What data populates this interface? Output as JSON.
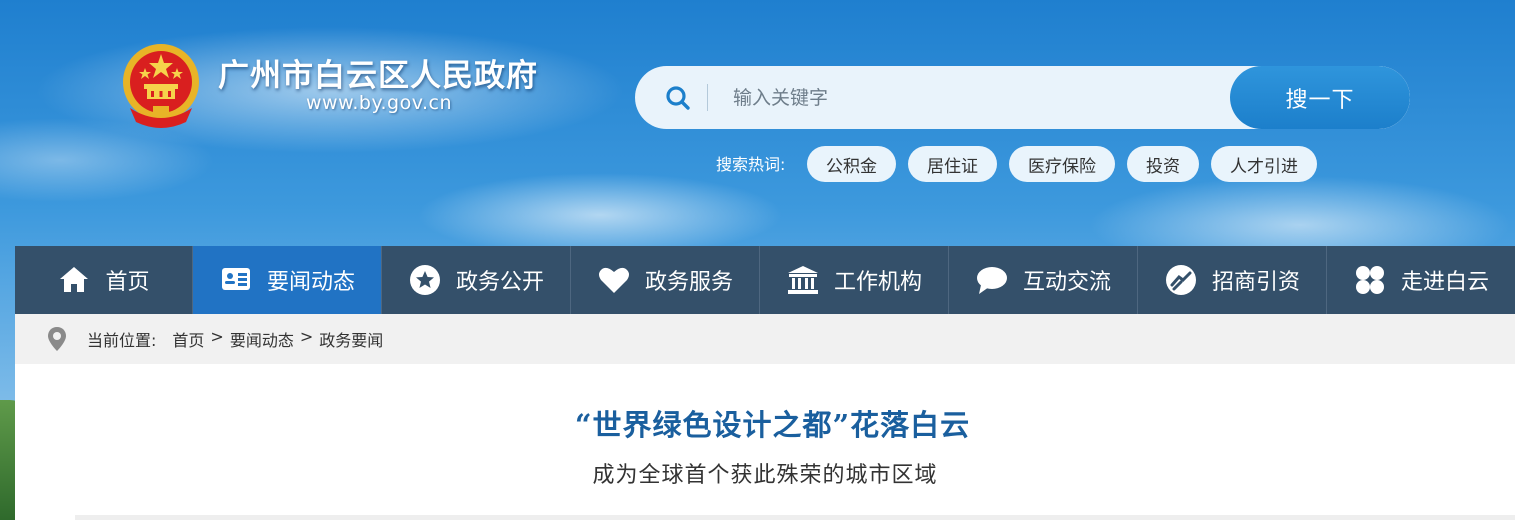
{
  "header": {
    "site_name": "广州市白云区人民政府",
    "site_url": "www.by.gov.cn"
  },
  "search": {
    "placeholder": "输入关键字",
    "button_label": "搜一下",
    "hot_label": "搜索热词:",
    "hot_terms": [
      "公积金",
      "居住证",
      "医疗保险",
      "投资",
      "人才引进"
    ]
  },
  "nav": {
    "items": [
      {
        "label": "首页",
        "icon": "home-icon"
      },
      {
        "label": "要闻动态",
        "icon": "news-card-icon"
      },
      {
        "label": "政务公开",
        "icon": "star-badge-icon"
      },
      {
        "label": "政务服务",
        "icon": "heart-icon"
      },
      {
        "label": "工作机构",
        "icon": "building-icon"
      },
      {
        "label": "互动交流",
        "icon": "chat-bubble-icon"
      },
      {
        "label": "招商引资",
        "icon": "handshake-icon"
      },
      {
        "label": "走进白云",
        "icon": "grid-clover-icon"
      }
    ],
    "active_index": 1
  },
  "breadcrumb": {
    "prefix": "当前位置:",
    "items": [
      "首页",
      "要闻动态",
      "政务要闻"
    ],
    "separator": ">"
  },
  "article": {
    "title": "“世界绿色设计之都”花落白云",
    "subtitle": "成为全球首个获此殊荣的城市区域"
  },
  "colors": {
    "nav_bg": "#34506a",
    "nav_active": "#2173c4",
    "title_blue": "#1a5f9e",
    "search_button": "#1c7fcb"
  }
}
